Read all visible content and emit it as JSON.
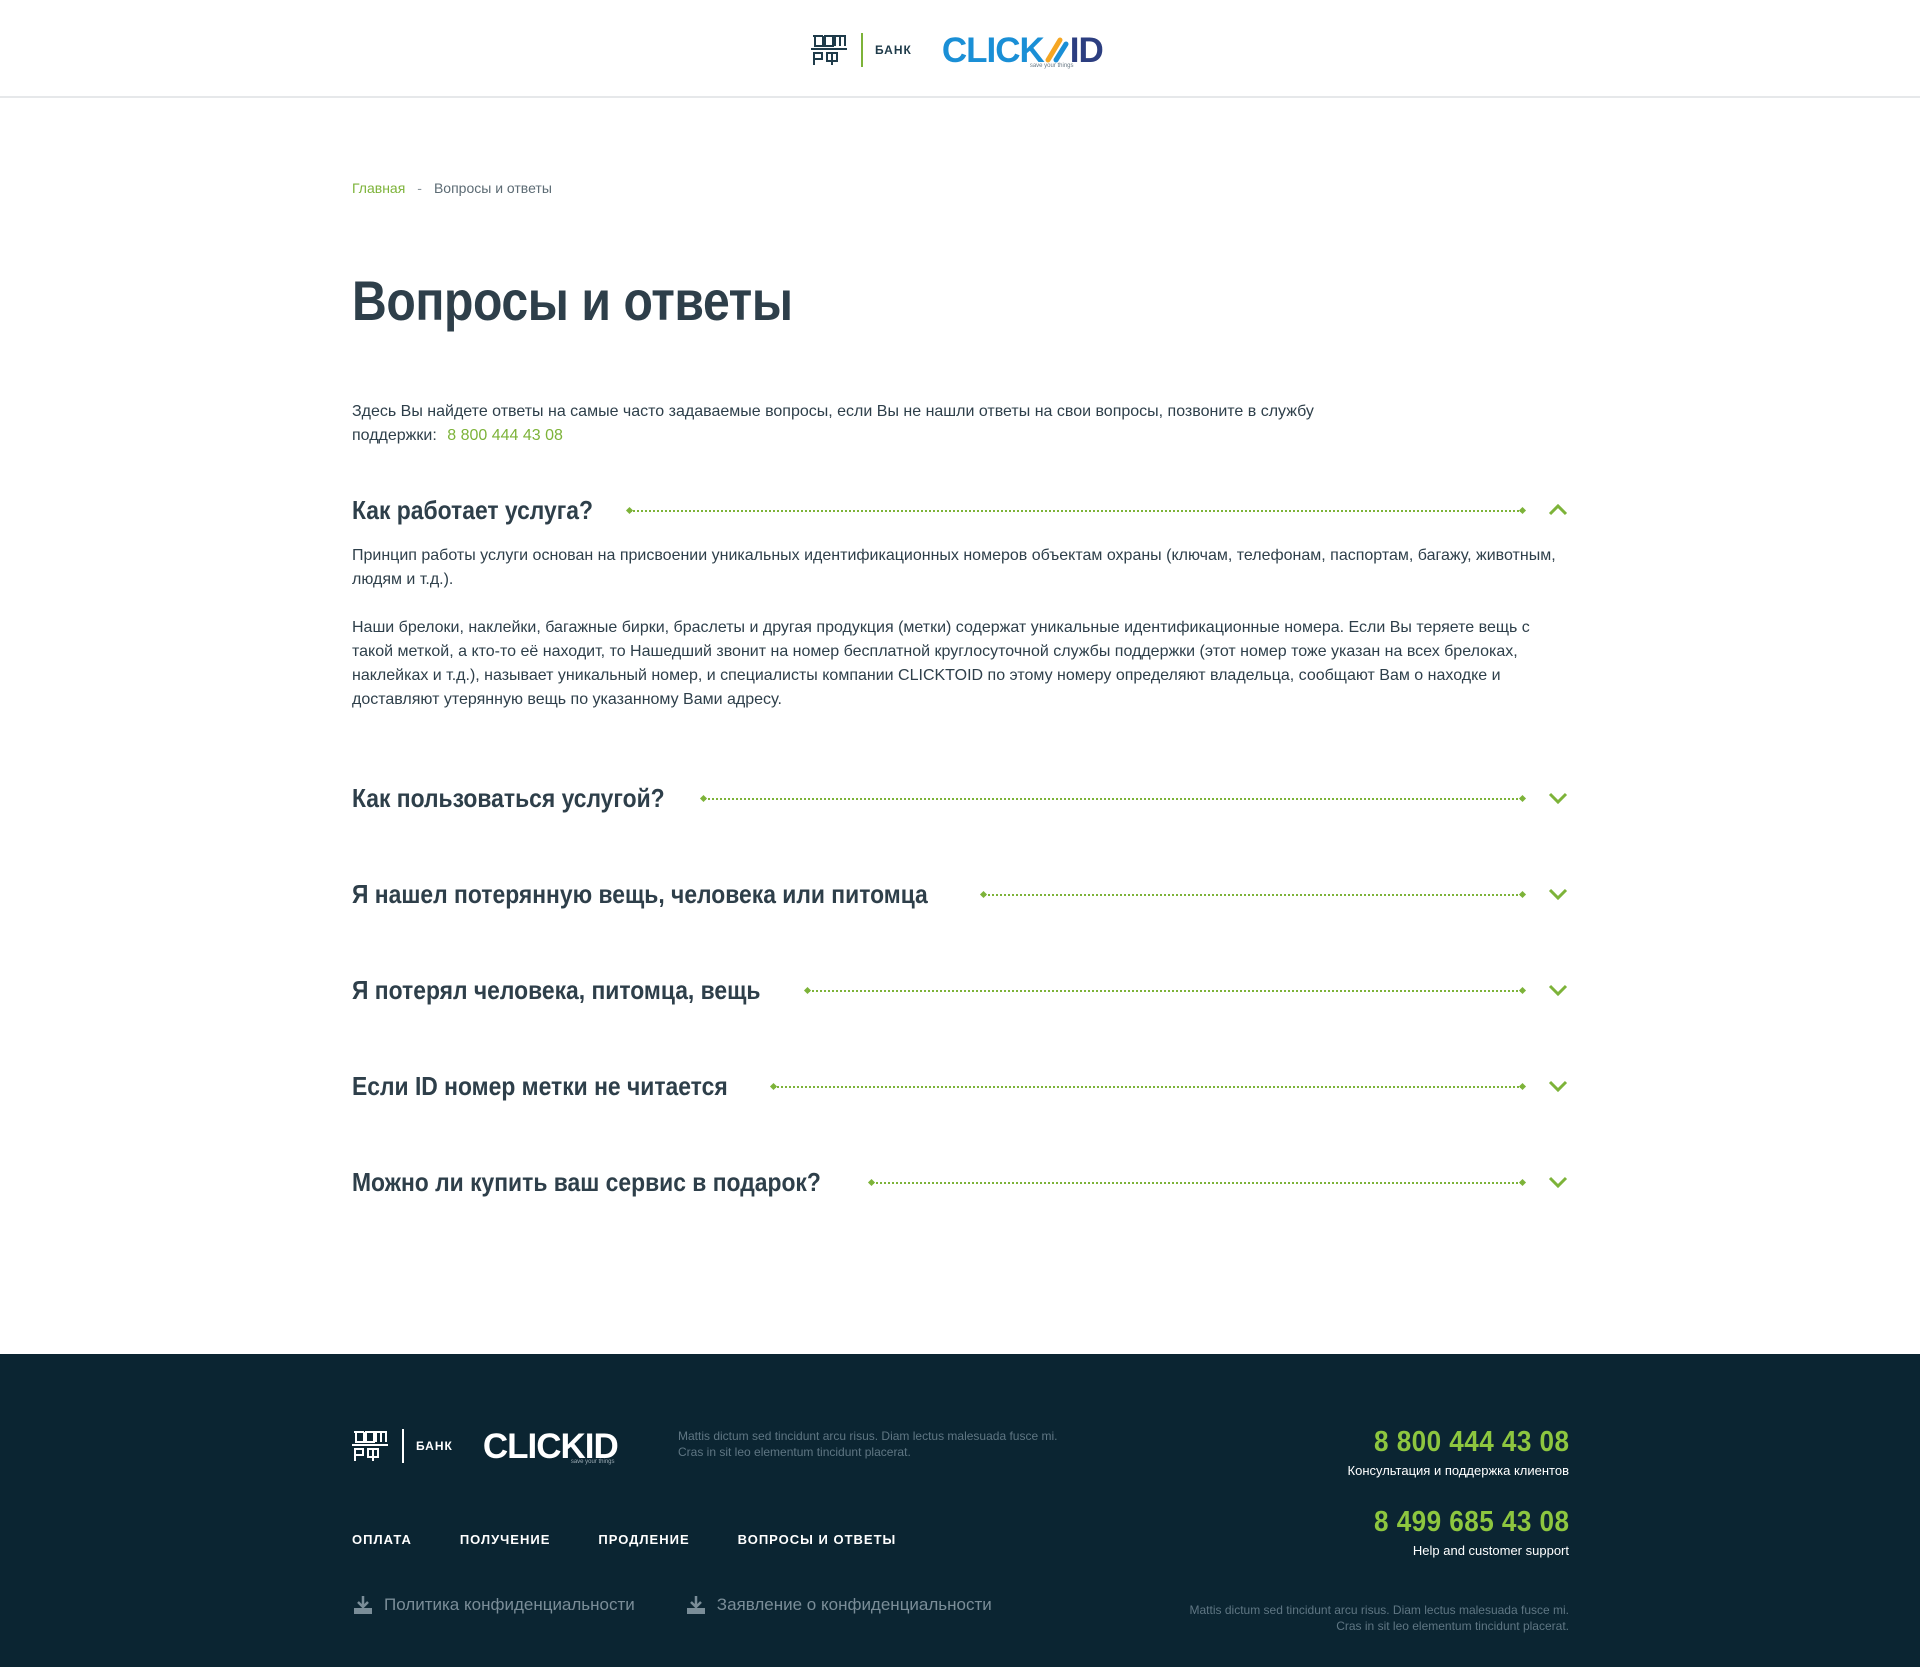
{
  "header": {
    "bank_label": "БАНК",
    "brand_part1": "CLICK",
    "brand_part2": "ID",
    "brand_tagline": "save your things"
  },
  "breadcrumb": {
    "home": "Главная",
    "separator": "-",
    "current": "Вопросы и ответы"
  },
  "page": {
    "title": "Вопросы и ответы",
    "intro_text": "Здесь Вы найдете ответы на самые часто задаваемые вопросы, если Вы не нашли ответы на свои вопросы, позвоните в службу поддержки:",
    "intro_phone": "8 800 444 43 08"
  },
  "faq": [
    {
      "question": "Как работает услуга?",
      "expanded": true,
      "answer_p1": "Принцип работы услуги основан на присвоении уникальных идентификационных номеров объектам охраны (ключам, телефонам, паспортам, багажу, животным, людям и т.д.).",
      "answer_p2": "Наши брелоки, наклейки, багажные бирки, браслеты и другая продукция (метки) содержат уникальные идентификационные номера. Если Вы теряете вещь с такой меткой, а кто-то её находит, то Нашедший звонит на номер бесплатной круглосуточной службы поддержки (этот номер тоже указан на всех брелоках, наклейках и т.д.), называет уникальный номер, и специалисты компании CLICKTOID по этому номеру определяют владельца, сообщают Вам о находке и доставляют утерянную вещь по указанному Вами адресу."
    },
    {
      "question": "Как пользоваться услугой?",
      "expanded": false
    },
    {
      "question": "Я нашел потерянную вещь, человека или питомца",
      "expanded": false
    },
    {
      "question": "Я потерял человека, питомца, вещь",
      "expanded": false
    },
    {
      "question": "Если ID номер метки не читается",
      "expanded": false
    },
    {
      "question": "Можно ли купить ваш сервис в подарок?",
      "expanded": false
    }
  ],
  "footer": {
    "bank_label": "БАНК",
    "brand": "CLICKID",
    "brand_tagline": "save your things",
    "description": "Mattis dictum sed tincidunt arcu risus. Diam lectus malesuada fusce mi. Cras in sit leo elementum tincidunt placerat.",
    "nav": [
      "ОПЛАТА",
      "ПОЛУЧЕНИЕ",
      "ПРОДЛЕНИЕ",
      "ВОПРОСЫ И ОТВЕТЫ"
    ],
    "docs": [
      "Политика конфиденциальности",
      "Заявление о конфиденциальности"
    ],
    "phone1": "8 800 444 43 08",
    "phone1_label": "Консультация и поддержка клиентов",
    "phone2": "8 499 685 43 08",
    "phone2_label": "Help and customer support",
    "copyright": "Mattis dictum sed tincidunt arcu risus. Diam lectus malesuada fusce mi. Cras in sit leo elementum tincidunt placerat."
  },
  "colors": {
    "accent_green": "#7db339",
    "footer_bg": "#0b2532",
    "text_dark": "#2e3f4a",
    "brand_blue": "#1a8fd6"
  }
}
